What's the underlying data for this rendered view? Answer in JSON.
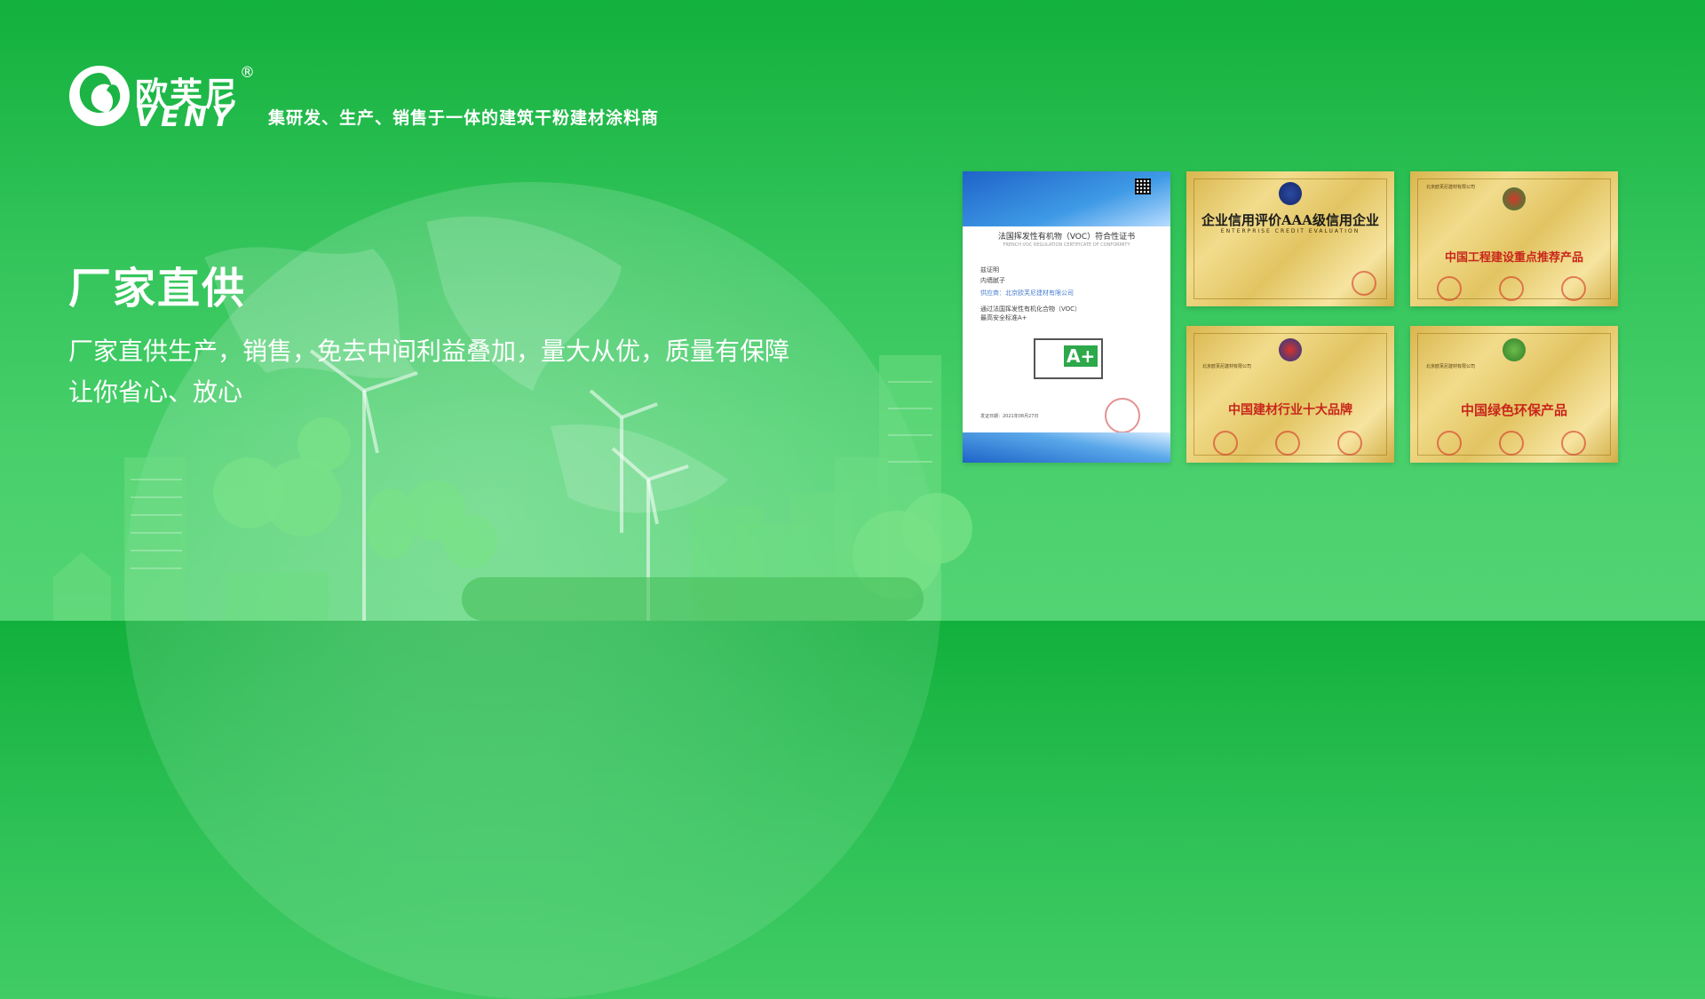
{
  "brand": {
    "name_cn": "欧芙尼",
    "registered_mark": "®",
    "name_en": "VENY",
    "slogan": "集研发、生产、销售于一体的建筑干粉建材涂料商"
  },
  "hero": {
    "headline": "厂家直供",
    "description_line1": "厂家直供生产，销售，免去中间利益叠加，量大从优，质量有保障",
    "description_line2": "让你省心、放心"
  },
  "certificates": {
    "voc": {
      "title": "法国挥发性有机物（VOC）符合性证书",
      "subtitle": "FRENCH VOC REGULATION CERTIFICATE OF CONFORMITY",
      "line_certify": "兹证明",
      "line_product": "内墙腻子",
      "line_supplier": "供应商：北京欧芙尼建材有限公司",
      "line_pass": "通过法国挥发性有机化合物（VOC）",
      "line_grade": "最高安全标准A+",
      "grade": "A+",
      "date": "发证日期：2021年08月27日"
    },
    "aaa": {
      "title": "企业信用评价AAA级信用企业",
      "subtitle": "ENTERPRISE CREDIT EVALUATION"
    },
    "engineering": {
      "company": "北京欧芙尼建材有限公司",
      "title": "中国工程建设重点推荐产品"
    },
    "top_ten": {
      "company": "北京欧芙尼建材有限公司",
      "title": "中国建材行业十大品牌"
    },
    "green": {
      "company": "北京欧芙尼建材有限公司",
      "title": "中国绿色环保产品"
    }
  },
  "colors": {
    "background_top": "#12b03c",
    "background_bottom": "#53d474",
    "text": "#ffffff",
    "certificate_red": "#c8261b"
  },
  "icons": {
    "logo": "veny-swirl-logo"
  }
}
